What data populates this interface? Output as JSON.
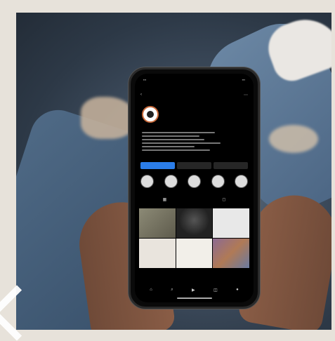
{
  "scene": {
    "description_tag": "",
    "profile": {
      "username": "",
      "stats": [
        {
          "number": "",
          "label": ""
        },
        {
          "number": "",
          "label": ""
        },
        {
          "number": "",
          "label": ""
        }
      ],
      "buttons": [
        "",
        "",
        ""
      ],
      "highlight_count": 5,
      "post_count": 6
    },
    "colors": {
      "background": "#e7e2da",
      "accent": "#2b7de9",
      "avatar_ring": "#c96b3c"
    },
    "icons": [
      "back-icon",
      "more-icon",
      "grid-icon",
      "tagged-icon",
      "home-icon",
      "search-icon",
      "reels-icon",
      "shop-icon",
      "profile-icon"
    ]
  }
}
